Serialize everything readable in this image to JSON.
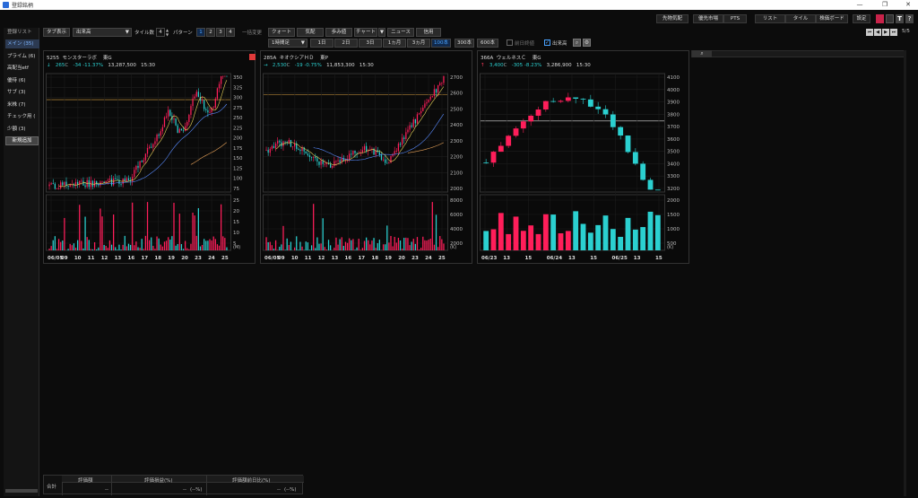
{
  "window": {
    "title": "登録銘柄",
    "controls": [
      "—",
      "❐",
      "✕"
    ]
  },
  "topbar": {
    "buttons": [
      {
        "label": "先物気配",
        "highlight": false
      },
      {
        "label": "優先市場",
        "highlight": true
      },
      {
        "label": "PTS",
        "highlight": false
      },
      {
        "label": "リスト",
        "highlight": false
      },
      {
        "label": "タイル",
        "highlight": true
      },
      {
        "label": "株価ボード",
        "highlight": false
      },
      {
        "label": "設定",
        "highlight": false
      }
    ],
    "page": "5/5"
  },
  "sidebar": {
    "header": "登録リスト",
    "items": [
      {
        "label": "メイン (35)",
        "selected": true
      },
      {
        "label": "プライム (6)",
        "selected": false
      },
      {
        "label": "高配当etf",
        "selected": false
      },
      {
        "label": "優待 (6)",
        "selected": false
      },
      {
        "label": "サブ (3)",
        "selected": false
      },
      {
        "label": "米株 (7)",
        "selected": false
      },
      {
        "label": "チェック用 (",
        "selected": false
      },
      {
        "label": "少額 (3)",
        "selected": false
      }
    ],
    "add_button": "新規追加"
  },
  "toolbar": {
    "tab_display": "タブ表示",
    "sort_value": "出来高",
    "tile_count_label": "タイル数",
    "tile_count": "4",
    "pattern_label": "パターン",
    "patterns": [
      "1",
      "2",
      "3",
      "4"
    ],
    "bulk_change": "一括変更",
    "tabs": [
      "クォート",
      "気配",
      "歩み値",
      "チャート",
      "ニュース",
      "信用"
    ],
    "chart_type": "1時間足",
    "periods": [
      "1日",
      "2日",
      "3日",
      "1ヵ月",
      "3ヵ月"
    ],
    "counts": [
      "100本",
      "300本",
      "600本"
    ],
    "active_count": "100本",
    "check_pre_close": "前日終値",
    "check_volume": "出来高"
  },
  "panels": [
    {
      "code": "5255",
      "name": "モンスターラボ",
      "market": "東G",
      "arrow": "↓",
      "price": "265",
      "price_flag": "C",
      "change": "-34",
      "change_pct": "-11.37%",
      "volume": "13,287,500",
      "time": "15:30",
      "price_ticks": [
        "350",
        "325",
        "300",
        "275",
        "250",
        "225",
        "200",
        "175",
        "150",
        "125",
        "100",
        "75"
      ],
      "vol_ticks": [
        "25",
        "20",
        "15",
        "10",
        "5"
      ],
      "vol_unit": "(M)",
      "dates": [
        "06/05",
        "09",
        "10",
        "11",
        "12",
        "13",
        "16",
        "17",
        "18",
        "19",
        "20",
        "23",
        "24",
        "25"
      ]
    },
    {
      "code": "285A",
      "name": "キオクシアＨＤ",
      "market": "東P",
      "arrow": "→",
      "price": "2,530",
      "price_flag": "C",
      "change": "-19",
      "change_pct": "-0.75%",
      "volume": "11,853,300",
      "time": "15:30",
      "price_ticks": [
        "2700",
        "2600",
        "2500",
        "2400",
        "2300",
        "2200",
        "2100",
        "2000"
      ],
      "vol_ticks": [
        "8000",
        "6000",
        "4000",
        "2000"
      ],
      "vol_unit": "(K)",
      "dates": [
        "06/05",
        "09",
        "10",
        "11",
        "12",
        "13",
        "16",
        "17",
        "18",
        "19",
        "20",
        "23",
        "24",
        "25"
      ]
    },
    {
      "code": "366A",
      "name": "ウェルネスＣ",
      "market": "東G",
      "arrow": "↑",
      "price": "3,400",
      "price_flag": "C",
      "change": "-305",
      "change_pct": "-8.23%",
      "volume": "3,286,900",
      "time": "15:30",
      "price_ticks": [
        "4100",
        "4000",
        "3900",
        "3800",
        "3700",
        "3600",
        "3500",
        "3400",
        "3300",
        "3200"
      ],
      "vol_ticks": [
        "2000",
        "1500",
        "1000",
        "500"
      ],
      "vol_unit": "(K)",
      "dates": [
        "06/23",
        "13",
        "15",
        "06/24",
        "13",
        "15",
        "06/25",
        "13",
        "15"
      ]
    }
  ],
  "summary": {
    "label": "合計",
    "cols": [
      "評価額",
      "評価損益(%)",
      "評価額前日比(%)"
    ],
    "vals": [
      "--",
      "--",
      "--"
    ],
    "pcts": [
      "",
      "(--%)",
      "(--%)"
    ]
  },
  "colors": {
    "up": "#ff1e5a",
    "down": "#2bd0d0",
    "accent": "#4aa3ff"
  }
}
